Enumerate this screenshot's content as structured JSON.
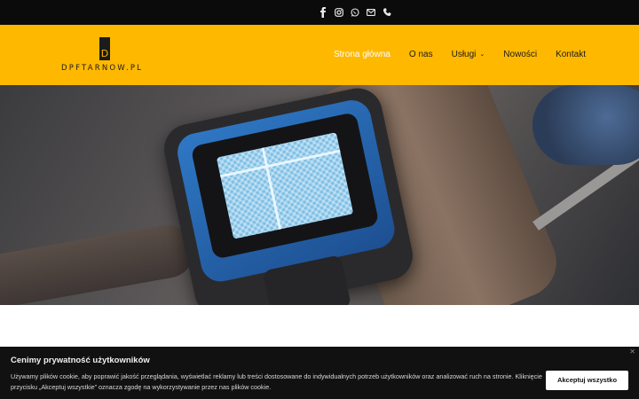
{
  "topbar": {
    "icons": [
      "facebook-icon",
      "instagram-icon",
      "whatsapp-icon",
      "mail-icon",
      "phone-icon"
    ]
  },
  "header": {
    "logo_text": "DPFTARNOW.PL",
    "nav": [
      {
        "label": "Strona główna",
        "active": true
      },
      {
        "label": "O nas"
      },
      {
        "label": "Usługi",
        "has_dropdown": true
      },
      {
        "label": "Nowości"
      },
      {
        "label": "Kontakt"
      }
    ]
  },
  "cookie": {
    "title": "Cenimy prywatność użytkowników",
    "text": "Używamy plików cookie, aby poprawić jakość przeglądania, wyświetlać reklamy lub treści dostosowane do indywidualnych potrzeb użytkowników oraz analizować ruch na stronie. Kliknięcie przycisku „Akceptuj wszystkie” oznacza zgodę na wykorzystywanie przez nas plików cookie.",
    "accept_label": "Akceptuj wszystko"
  },
  "colors": {
    "brand": "#ffb800",
    "topbar": "#0b0b0b",
    "cookie_bg": "#111111"
  }
}
